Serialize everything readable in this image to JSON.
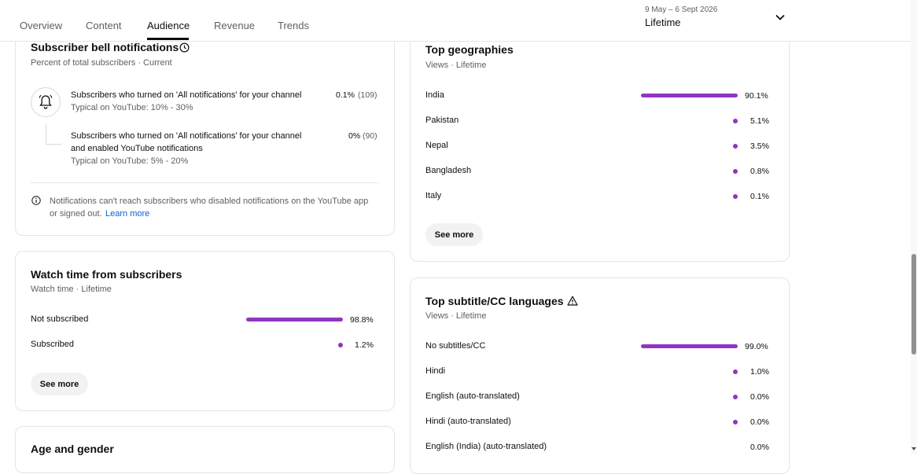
{
  "tabs": [
    "Overview",
    "Content",
    "Audience",
    "Revenue",
    "Trends"
  ],
  "date_range": "9 May – 6 Sept 2026",
  "period": "Lifetime",
  "bell": {
    "title": "Subscriber bell notifications",
    "subtitle": "Percent of total subscribers · Current",
    "item1_text": "Subscribers who turned on 'All notifications' for your channel",
    "item1_typical": "Typical on YouTube: 10% - 30%",
    "item1_pct": "0.1%",
    "item1_count": "(109)",
    "item2_text_line1": "Subscribers who turned on 'All notifications' for your channel",
    "item2_text_line2": "and enabled YouTube notifications",
    "item2_typical": "Typical on YouTube: 5% - 20%",
    "item2_pct": "0%",
    "item2_count": "(90)",
    "note_line1": "Notifications can't reach subscribers who disabled notifications on the YouTube app",
    "note_line2": "or signed out.",
    "note_link": "Learn more"
  },
  "watch_time": {
    "title": "Watch time from subscribers",
    "subtitle": "Watch time · Lifetime",
    "rows": [
      {
        "label": "Not subscribed",
        "value": "98.8%",
        "fraction": 0.988
      },
      {
        "label": "Subscribed",
        "value": "1.2%",
        "fraction": 0.012
      }
    ],
    "see_more": "See more"
  },
  "age_gender": {
    "title": "Age and gender"
  },
  "geographies": {
    "title": "Top geographies",
    "subtitle": "Views · Lifetime",
    "rows": [
      {
        "label": "India",
        "value": "90.1%",
        "fraction": 0.901
      },
      {
        "label": "Pakistan",
        "value": "5.1%",
        "fraction": 0.051
      },
      {
        "label": "Nepal",
        "value": "3.5%",
        "fraction": 0.035
      },
      {
        "label": "Bangladesh",
        "value": "0.8%",
        "fraction": 0.008
      },
      {
        "label": "Italy",
        "value": "0.1%",
        "fraction": 0.001
      }
    ],
    "see_more": "See more"
  },
  "subtitles": {
    "title": "Top subtitle/CC languages",
    "subtitle": "Views · Lifetime",
    "rows": [
      {
        "label": "No subtitles/CC",
        "value": "99.0%",
        "fraction": 0.99
      },
      {
        "label": "Hindi",
        "value": "1.0%",
        "fraction": 0.01
      },
      {
        "label": "English (auto-translated)",
        "value": "0.0%",
        "fraction": 0.0001
      },
      {
        "label": "Hindi (auto-translated)",
        "value": "0.0%",
        "fraction": 0.0001
      },
      {
        "label": "English (India) (auto-translated)",
        "value": "0.0%",
        "fraction": 0
      }
    ]
  },
  "colors": {
    "bar": "#9334c1",
    "link": "#065fd4"
  }
}
